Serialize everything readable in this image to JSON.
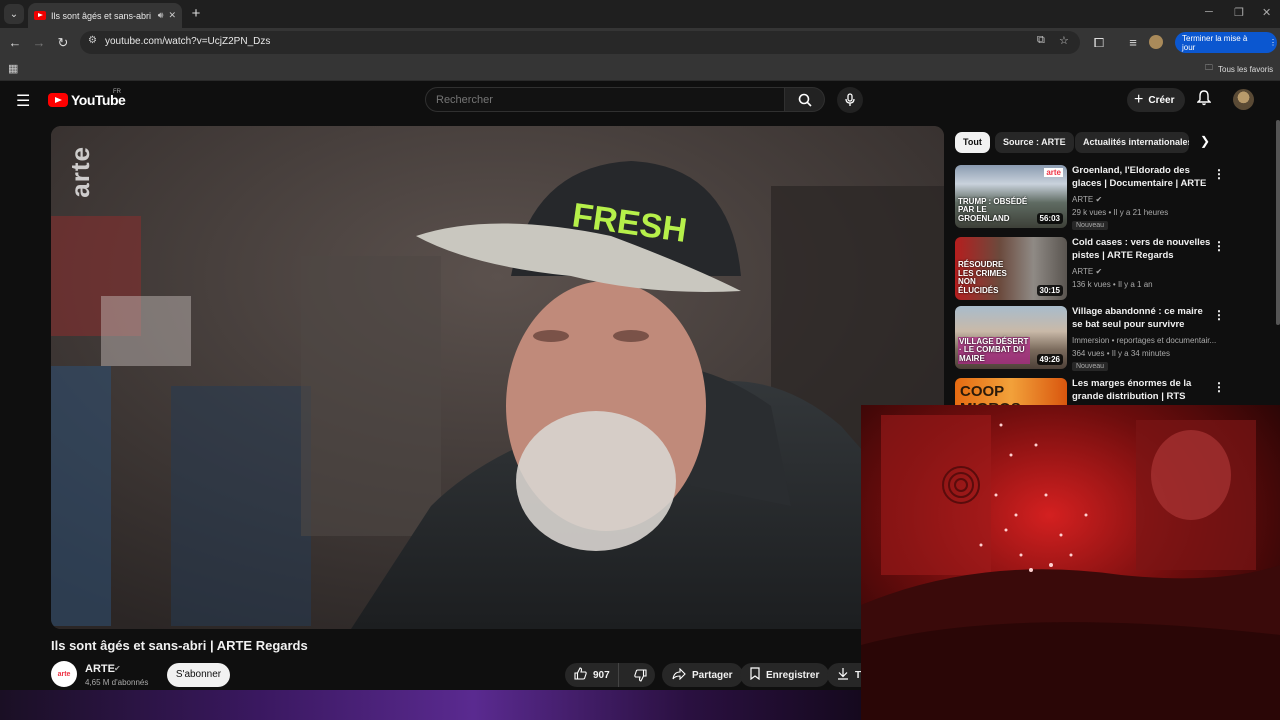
{
  "browser": {
    "tab_title": "Ils sont âgés et sans-abri | ARTE",
    "url": "youtube.com/watch?v=UcjZ2PN_Dzs",
    "update_button": "Terminer la mise à jour",
    "all_bookmarks": "Tous les favoris"
  },
  "header": {
    "logo_text": "YouTube",
    "country": "FR",
    "search_placeholder": "Rechercher",
    "create_label": "Créer"
  },
  "video": {
    "watermark": "arte",
    "title": "Ils sont âgés et sans-abri | ARTE Regards",
    "channel": {
      "name": "ARTE",
      "avatar_text": "arte",
      "subscribers": "4,65 M d'abonnés"
    },
    "subscribe_label": "S'abonner",
    "likes": "907",
    "share_label": "Partager",
    "save_label": "Enregistrer",
    "download_label": "Té"
  },
  "sidebar": {
    "chips": [
      "Tout",
      "Source : ARTE",
      "Actualités internationales"
    ],
    "recommendations": [
      {
        "title": "Groenland, l'Eldorado des glaces | Documentaire | ARTE",
        "channel": "ARTE",
        "verified": true,
        "meta": "29 k vues • Il y a 21 heures",
        "badge": "Nouveau",
        "duration": "56:03",
        "thumb_text": "TRUMP : OBSÉDÉ PAR LE GROENLAND"
      },
      {
        "title": "Cold cases : vers de nouvelles pistes | ARTE Regards",
        "channel": "ARTE",
        "verified": true,
        "meta": "136 k vues • Il y a 1 an",
        "badge": "",
        "duration": "30:15",
        "thumb_text": "RÉSOUDRE LES CRIMES NON ÉLUCIDÉS"
      },
      {
        "title": "Village abandonné : ce maire se bat seul pour survivre",
        "channel": "Immersion • reportages et documentair...",
        "verified": false,
        "meta": "364 vues • Il y a 34 minutes",
        "badge": "Nouveau",
        "duration": "49:26",
        "thumb_text": "VILLAGE DÉSERT · LE COMBAT DU MAIRE"
      },
      {
        "title": "Les marges énormes de la grande distribution | RTS",
        "channel": "",
        "verified": false,
        "meta": "",
        "badge": "",
        "duration": "",
        "thumb_text": "COOP MIGROS"
      }
    ]
  },
  "colors": {
    "background": "#0f0f0f",
    "brand_red": "#ff0000",
    "chip_active": "#f1f1f1",
    "update_blue": "#0b57d0"
  }
}
